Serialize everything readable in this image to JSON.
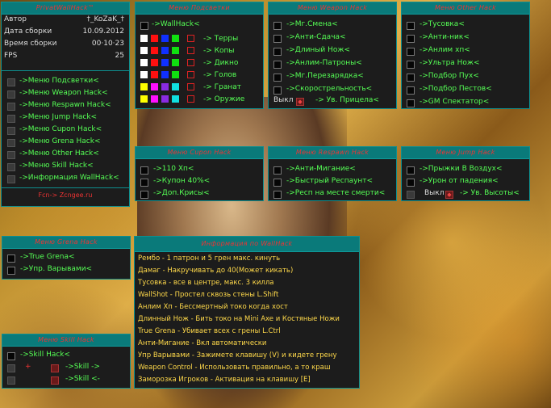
{
  "main": {
    "title": "PrivatWallHack™",
    "info": [
      {
        "label": "Автор",
        "value": "†_KoZaK_†"
      },
      {
        "label": "Дата сборки",
        "value": "10.09.2012"
      },
      {
        "label": "Время сборки",
        "value": "00·10·23"
      },
      {
        "label": "FPS",
        "value": "25"
      }
    ],
    "menu": [
      "->Меню Подсветки<",
      "->Меню Weapon Hack<",
      "->Меню Respawn Hack<",
      "->Меню Jump Hack<",
      "->Меню Cupon Hack<",
      "->Меню Grena Hack<",
      "->Меню Other Hack<",
      "->Меню Skill Hack<",
      "->Информация WallHack<"
    ],
    "footer": "Fcn-> Zcngee.ru"
  },
  "highlight": {
    "title": "Меню Подсветки",
    "top": "->WallHack<",
    "rows": [
      {
        "label": "-> Терры",
        "colors": [
          "#ffffff",
          "#ff1010",
          "#1030ff",
          "#10e010"
        ]
      },
      {
        "label": "-> Копы",
        "colors": [
          "#ffffff",
          "#ff1010",
          "#1030ff",
          "#10e010"
        ]
      },
      {
        "label": "-> Дикно",
        "colors": [
          "#ffffff",
          "#ff1010",
          "#1030ff",
          "#10e010"
        ]
      },
      {
        "label": "-> Голов",
        "colors": [
          "#ffffff",
          "#ff1010",
          "#1030ff",
          "#10e010"
        ]
      },
      {
        "label": "-> Гранат",
        "colors": [
          "#ffff00",
          "#ff10ff",
          "#8a2be2",
          "#10e0e0"
        ]
      },
      {
        "label": "-> Оружие",
        "colors": [
          "#ffff00",
          "#ff10ff",
          "#8a2be2",
          "#10e0e0"
        ]
      }
    ]
  },
  "weapon": {
    "title": "Меню Weapon Hack",
    "items": [
      "->Мг.Смена<",
      "->Анти-Сдача<",
      "->Длиный Нож<",
      "->Анлим-Патроны<",
      "->Мг.Перезарядка<",
      "->Скорострельность<"
    ],
    "off_label": "Выкл",
    "last": "-> Ув. Прицела<"
  },
  "other": {
    "title": "Меню Other Hack",
    "items": [
      "->Тусовка<",
      "->Анти-ник<",
      "->Анлим хп<",
      "->Ультра Нож<",
      "->Подбор Пух<",
      "->Подбор Пестов<",
      "->GM Спектатор<"
    ]
  },
  "cupon": {
    "title": "Меню Cupon Hack",
    "items": [
      "->110 Хп<",
      "->Купон 40%<",
      "->Доп.Крисы<"
    ]
  },
  "respawn": {
    "title": "Меню Respawn Hack",
    "items": [
      "->Анти-Мигание<",
      "->Быстрый Респаунт<",
      "->Респ на месте смерти<"
    ]
  },
  "jump": {
    "title": "Меню Jump Hack",
    "items": [
      "->Прыжки В Воздух<",
      "->Урон от падения<"
    ],
    "off_label": "Выкл",
    "last": "-> Ув. Высоты<"
  },
  "grena": {
    "title": "Меню Grena Hack",
    "items": [
      "->True Grena<",
      "->Упр. Варывами<"
    ]
  },
  "skill": {
    "title": "Меню Skill Hack",
    "items": [
      "->Skill Hack<",
      "->Skill ->",
      "->Skill <-"
    ],
    "plus": "+"
  },
  "infopanel": {
    "title": "Информация по WallHack",
    "lines": [
      "Рембо - 1 патрон и 5 грен макс. кинуть",
      "Дамаг - Накручивать до 40(Может кикать)",
      "Тусовка - все в центре, макс. 3 килла",
      "WallShot - Простел сквозь стены L.Shift",
      "Анлим Хп - Бессмертный токо когда хост",
      "Длинный Нож - Бить токо на Mini Axe и Костяные Ножи",
      "True Grena - Убивает всех с грены L.Ctrl",
      "Анти-Мигание - Вкл автоматически",
      "Упр Варывами - Зажимете клавишу (V) и кидете грену",
      "Weapon Control - Использовать правильно, а то краш",
      "Заморозка Игроков - Активация на клавишу [E]"
    ]
  },
  "colors": {
    "panel_bg": "#1c1c1c",
    "title_bg": "#0a7a7a",
    "title_text": "#ee3333",
    "item_text": "#55ff55",
    "info_text": "#ffd94a"
  }
}
